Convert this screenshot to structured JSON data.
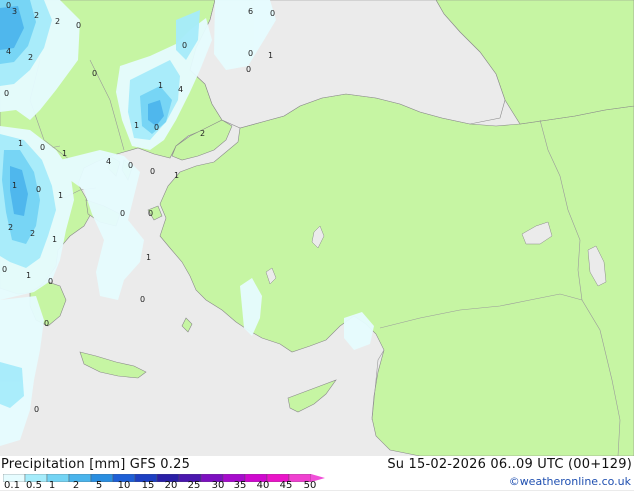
{
  "title": {
    "left": "Precipitation [mm]  GFS 0.25",
    "right": "Su 15-02-2026 06..09 UTC (00+129)"
  },
  "credit": "©weatheronline.co.uk",
  "legend": {
    "ticks": [
      "0.1",
      "0.5",
      "1",
      "2",
      "5",
      "10",
      "15",
      "20",
      "25",
      "30",
      "35",
      "40",
      "45",
      "50"
    ],
    "colors": [
      "#e6fcff",
      "#a6ecfb",
      "#74d4f4",
      "#4ab4ec",
      "#2a8ee0",
      "#1e5fd6",
      "#1d3fc2",
      "#2a1fa6",
      "#4a17ae",
      "#7d10c0",
      "#a60ccc",
      "#cf09cf",
      "#ea14c8",
      "#f040d0"
    ]
  },
  "map": {
    "land_color": "#c6f5a3",
    "sea_color": "#ebebeb",
    "value_labels": [
      {
        "id": "v1",
        "text": "3"
      },
      {
        "id": "v2",
        "text": "2"
      },
      {
        "id": "v3",
        "text": "2"
      },
      {
        "id": "v4",
        "text": "0"
      },
      {
        "id": "v5",
        "text": "4"
      },
      {
        "id": "v6",
        "text": "2"
      },
      {
        "id": "v7",
        "text": "0"
      },
      {
        "id": "v8",
        "text": "0"
      },
      {
        "id": "v9",
        "text": "6"
      },
      {
        "id": "v10",
        "text": "0"
      },
      {
        "id": "v11",
        "text": "0"
      },
      {
        "id": "v12",
        "text": "1"
      },
      {
        "id": "v13",
        "text": "1"
      },
      {
        "id": "v14",
        "text": "4"
      },
      {
        "id": "v15",
        "text": "1"
      },
      {
        "id": "v16",
        "text": "0"
      },
      {
        "id": "v17",
        "text": "2"
      },
      {
        "id": "v18",
        "text": "1"
      },
      {
        "id": "v19",
        "text": "0"
      },
      {
        "id": "v20",
        "text": "1"
      },
      {
        "id": "v21",
        "text": "4"
      },
      {
        "id": "v22",
        "text": "0"
      },
      {
        "id": "v23",
        "text": "0"
      },
      {
        "id": "v24",
        "text": "1"
      },
      {
        "id": "v25",
        "text": "1"
      },
      {
        "id": "v26",
        "text": "0"
      },
      {
        "id": "v27",
        "text": "1"
      },
      {
        "id": "v28",
        "text": "0"
      },
      {
        "id": "v29",
        "text": "2"
      },
      {
        "id": "v30",
        "text": "2"
      },
      {
        "id": "v31",
        "text": "1"
      },
      {
        "id": "v32",
        "text": "1"
      },
      {
        "id": "v33",
        "text": "0"
      },
      {
        "id": "v34",
        "text": "1"
      },
      {
        "id": "v35",
        "text": "0"
      },
      {
        "id": "v36",
        "text": "0"
      },
      {
        "id": "v37",
        "text": "0"
      },
      {
        "id": "v38",
        "text": "0"
      },
      {
        "id": "v39",
        "text": "0"
      },
      {
        "id": "v40",
        "text": "0"
      },
      {
        "id": "v41",
        "text": "0"
      },
      {
        "id": "v42",
        "text": "0"
      }
    ]
  }
}
